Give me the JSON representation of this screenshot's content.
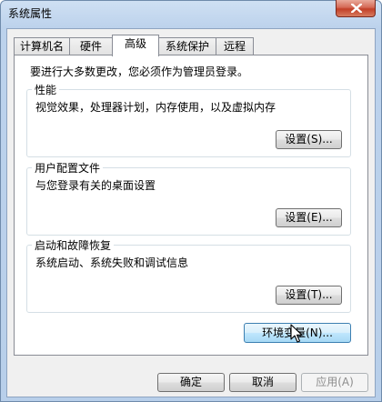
{
  "window": {
    "title": "系统属性"
  },
  "tabs": [
    {
      "label": "计算机名",
      "active": false
    },
    {
      "label": "硬件",
      "active": false
    },
    {
      "label": "高级",
      "active": true
    },
    {
      "label": "系统保护",
      "active": false
    },
    {
      "label": "远程",
      "active": false
    }
  ],
  "advanced": {
    "notice": "要进行大多数更改，您必须作为管理员登录。",
    "performance": {
      "title": "性能",
      "description": "视觉效果，处理器计划，内存使用，以及虚拟内存",
      "button": "设置(S)..."
    },
    "user_profiles": {
      "title": "用户配置文件",
      "description": "与您登录有关的桌面设置",
      "button": "设置(E)..."
    },
    "startup_recovery": {
      "title": "启动和故障恢复",
      "description": "系统启动、系统失败和调试信息",
      "button": "设置(T)..."
    },
    "env_button": "环境变量(N)..."
  },
  "footer": {
    "ok": "确定",
    "cancel": "取消",
    "apply": "应用(A)"
  },
  "icons": {
    "close": "close-icon",
    "cursor": "mouse-pointer-icon"
  }
}
